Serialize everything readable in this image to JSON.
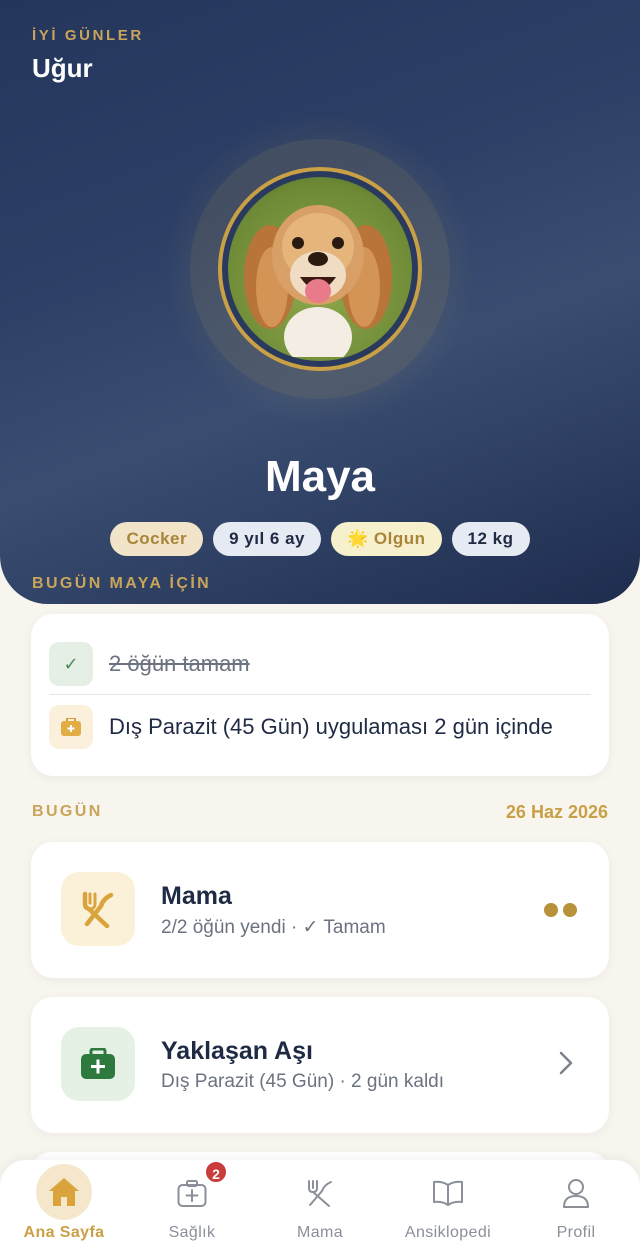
{
  "header": {
    "greeting": "İYİ GÜNLER",
    "username": "Uğur",
    "pet_name": "Maya",
    "tags": {
      "breed": "Cocker",
      "age": "9 yıl 6 ay",
      "stage": "🌟 Olgun",
      "weight": "12 kg"
    }
  },
  "today_for_pet": {
    "label": "BUGÜN MAYA İÇİN",
    "items": [
      {
        "text": "2 öğün tamam",
        "done": true,
        "icon": "check-icon"
      },
      {
        "text": "Dış Parazit (45 Gün) uygulaması 2 gün içinde",
        "done": false,
        "icon": "medkit-icon"
      }
    ]
  },
  "today": {
    "label": "BUGÜN",
    "date": "26 Haz 2026",
    "cards": [
      {
        "title": "Mama",
        "subtitle": "2/2 öğün yendi  ·  ✓ Tamam",
        "icon": "fork-knife-icon",
        "meals_done": 2
      },
      {
        "title": "Yaklaşan Aşı",
        "subtitle": "Dış Parazit (45 Gün) · 2 gün kaldı",
        "icon": "medkit-icon"
      }
    ]
  },
  "nav": {
    "items": [
      {
        "label": "Ana Sayfa",
        "icon": "home-icon",
        "active": true
      },
      {
        "label": "Sağlık",
        "icon": "health-icon",
        "badge": "2"
      },
      {
        "label": "Mama",
        "icon": "fork-knife-icon"
      },
      {
        "label": "Ansiklopedi",
        "icon": "book-icon"
      },
      {
        "label": "Profil",
        "icon": "person-icon"
      }
    ]
  },
  "colors": {
    "accent": "#c9a045",
    "hero_bg": "#2c3f66",
    "page_bg": "#f8f4ee"
  }
}
